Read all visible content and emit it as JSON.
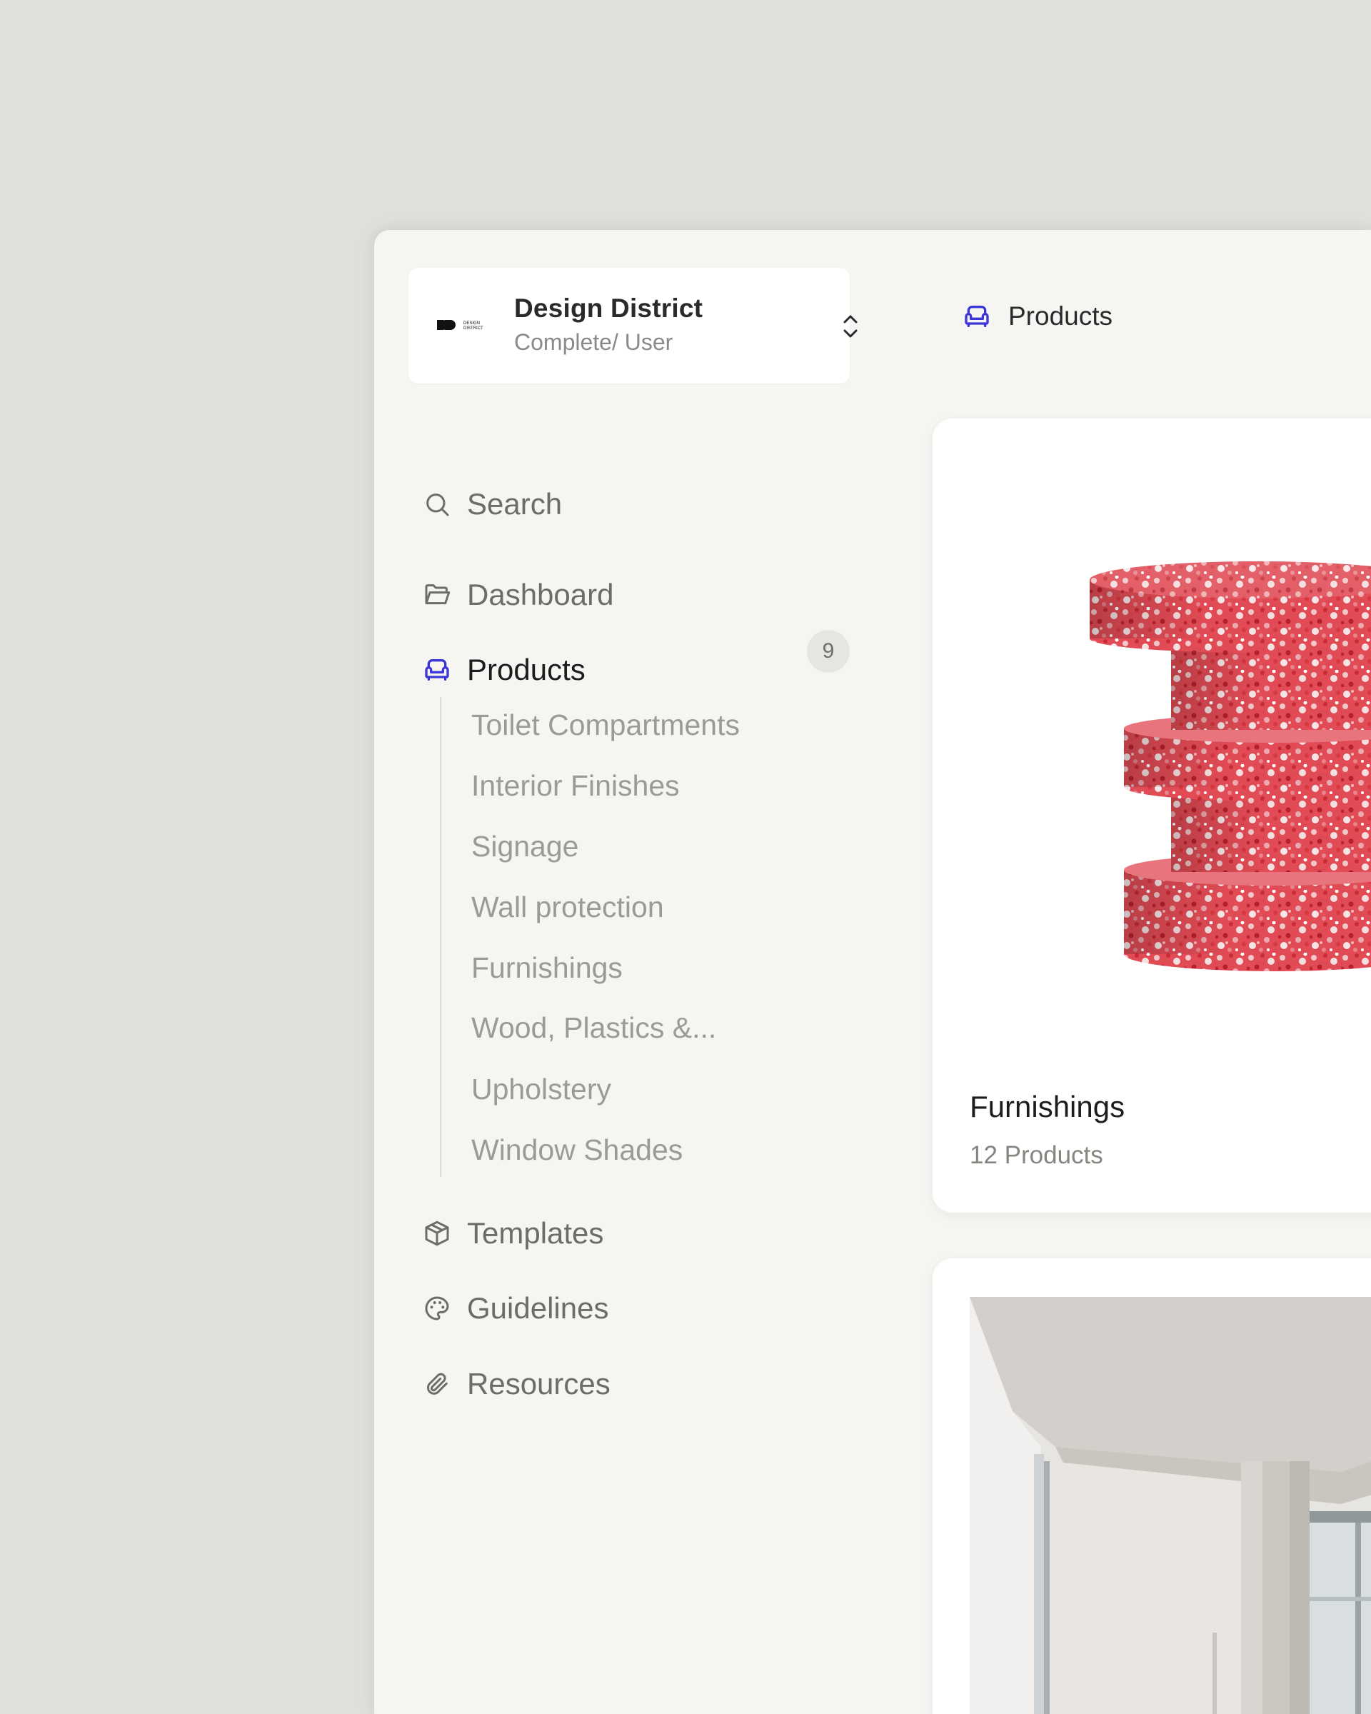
{
  "workspace": {
    "name": "Design District",
    "role": "Complete/ User",
    "logo_text": "DESIGN DISTRICT"
  },
  "header": {
    "title": "Products",
    "icon": "armchair-icon"
  },
  "sidebar": {
    "search_label": "Search",
    "items": [
      {
        "label": "Dashboard",
        "icon": "folder-open-icon"
      },
      {
        "label": "Products",
        "icon": "armchair-icon",
        "count": "9",
        "active": true
      },
      {
        "label": "Templates",
        "icon": "box-icon"
      },
      {
        "label": "Guidelines",
        "icon": "palette-icon"
      },
      {
        "label": "Resources",
        "icon": "paperclip-icon"
      }
    ],
    "subitems": [
      "Toilet Compartments",
      "Interior Finishes",
      "Signage",
      "Wall protection",
      "Furnishings",
      "Wood, Plastics &...",
      "Upholstery",
      "Window Shades"
    ]
  },
  "cards": [
    {
      "title": "Furnishings",
      "subtitle": "12 Products"
    }
  ],
  "colors": {
    "accent": "#3b36d6",
    "background": "#e1dfda",
    "panel": "#f6f5f2"
  }
}
